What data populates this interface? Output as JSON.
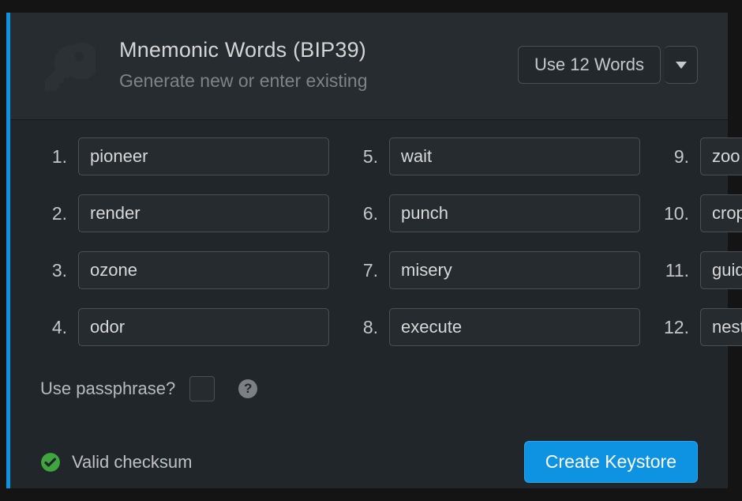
{
  "header": {
    "title": "Mnemonic Words (BIP39)",
    "subtitle": "Generate new or enter existing",
    "word_count_label": "Use 12 Words"
  },
  "words": [
    {
      "index": "1.",
      "value": "pioneer"
    },
    {
      "index": "2.",
      "value": "render"
    },
    {
      "index": "3.",
      "value": "ozone"
    },
    {
      "index": "4.",
      "value": "odor"
    },
    {
      "index": "5.",
      "value": "wait"
    },
    {
      "index": "6.",
      "value": "punch"
    },
    {
      "index": "7.",
      "value": "misery"
    },
    {
      "index": "8.",
      "value": "execute"
    },
    {
      "index": "9.",
      "value": "zoo"
    },
    {
      "index": "10.",
      "value": "crop"
    },
    {
      "index": "11.",
      "value": "guide"
    },
    {
      "index": "12.",
      "value": "nest"
    }
  ],
  "passphrase": {
    "label": "Use passphrase?",
    "checked": false,
    "help": "?"
  },
  "status": {
    "text": "Valid checksum",
    "ok": true
  },
  "actions": {
    "create_label": "Create Keystore"
  },
  "colors": {
    "accent": "#0d93e2",
    "success": "#3fa53f"
  }
}
